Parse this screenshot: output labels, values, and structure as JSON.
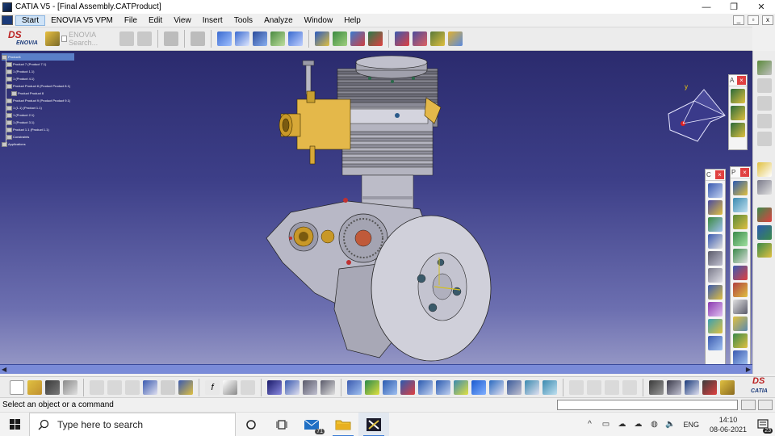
{
  "window": {
    "title": "CATIA V5 - [Final Assembly.CATProduct]",
    "minimize": "—",
    "restore": "❐",
    "close": "✕"
  },
  "menubar": {
    "items": [
      "Start",
      "ENOVIA V5 VPM",
      "File",
      "Edit",
      "View",
      "Insert",
      "Tools",
      "Analyze",
      "Window",
      "Help"
    ]
  },
  "toolbar": {
    "enovia_logo_ds": "DS",
    "enovia_logo_text": "ENOVIA",
    "enovia_search_placeholder": "ENOVIA Search...",
    "catia_logo_ds": "DS",
    "catia_logo_text": "CATIA"
  },
  "spec_tree": {
    "nodes": [
      "Product1",
      "Product 7 (Product 7.1)",
      "1 (Product 1.1)",
      "1 (Product 4.1)",
      "Product Product 8 (Product Product 8.1)",
      "Product Product 8",
      "Product Product 9 (Product Product 9.1)",
      "1 (1.1) (Product 1.1)",
      "1 (Product 2.1)",
      "1 (Product 3.1)",
      "Product 1.1 (Product 1.1)",
      "Constraints",
      "Applications"
    ]
  },
  "compass": {
    "axis_label": "y"
  },
  "right_toolbars": {
    "a_title": "A",
    "c_title": "C",
    "p_title": "P",
    "close": "×"
  },
  "status": {
    "text": "Select an object or a command"
  },
  "taskbar": {
    "search_placeholder": "Type here to search",
    "mail_badge": "71",
    "language": "ENG",
    "time": "14:10",
    "date": "08-06-2021",
    "notification_count": "23"
  },
  "colors": {
    "viewport_top": "#2b2b6e",
    "viewport_bottom": "#9a9cc8",
    "engine_gray": "#c9c9d2",
    "carburetor_yellow": "#e4b84a"
  }
}
